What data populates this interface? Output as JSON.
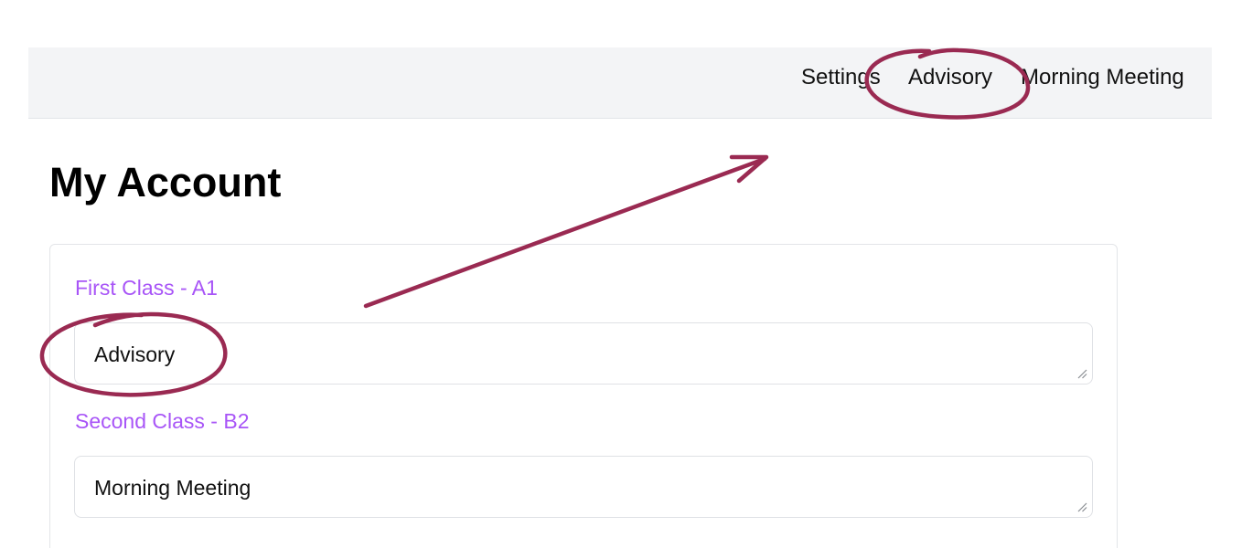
{
  "navbar": {
    "items": [
      {
        "label": "Settings"
      },
      {
        "label": "Advisory"
      },
      {
        "label": "Morning Meeting"
      }
    ]
  },
  "page": {
    "title": "My Account"
  },
  "form": {
    "fields": [
      {
        "label": "First Class - A1",
        "value": "Advisory"
      },
      {
        "label": "Second Class - B2",
        "value": "Morning Meeting"
      }
    ]
  },
  "colors": {
    "navbar_bg": "#f3f4f6",
    "label_color": "#a855f7",
    "annotation_color": "#9a2a52"
  },
  "annotations": {
    "circle_icon": "hand-drawn-circle",
    "arrow_icon": "hand-drawn-arrow"
  }
}
